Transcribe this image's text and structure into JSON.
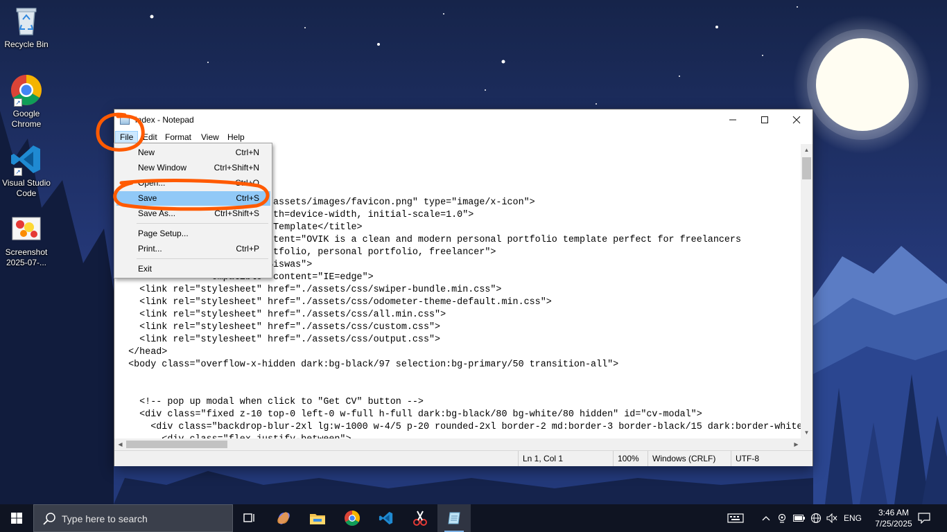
{
  "desktop": {
    "icons": [
      {
        "label": "Recycle Bin",
        "icon": "recycle-bin-icon"
      },
      {
        "label": "Google Chrome",
        "icon": "chrome-icon"
      },
      {
        "label": "Visual Studio Code",
        "icon": "vscode-icon"
      },
      {
        "label": "Screenshot 2025-07-...",
        "icon": "image-file-icon"
      }
    ]
  },
  "notepad": {
    "title": "index - Notepad",
    "menu": [
      "File",
      "Edit",
      "Format",
      "View",
      "Help"
    ],
    "active_menu": "File",
    "code_lines": [
      "",
      "",
      "",
      "",
      "                  \" href=\"./assets/images/favicon.png\" type=\"image/x-icon\">",
      "                 ontent=\"width=device-width, initial-scale=1.0\">",
      "                  Portfolio Template</title>",
      "                 iption\" content=\"OVIK is a clean and modern personal portfolio template perfect for freelancers",
      "                 ontent=\"portfolio, personal portfolio, freelancer\">",
      "                 ent=\"Ovik Biswas\">",
      "                 ompatible\" content=\"IE=edge\">",
      "    <link rel=\"stylesheet\" href=\"./assets/css/swiper-bundle.min.css\">",
      "    <link rel=\"stylesheet\" href=\"./assets/css/odometer-theme-default.min.css\">",
      "    <link rel=\"stylesheet\" href=\"./assets/css/all.min.css\">",
      "    <link rel=\"stylesheet\" href=\"./assets/css/custom.css\">",
      "    <link rel=\"stylesheet\" href=\"./assets/css/output.css\">",
      "  </head>",
      "  <body class=\"overflow-x-hidden dark:bg-black/97 selection:bg-primary/50 transition-all\">",
      "",
      "",
      "    <!-- pop up modal when click to \"Get CV\" button -->",
      "    <div class=\"fixed z-10 top-0 left-0 w-full h-full dark:bg-black/80 bg-white/80 hidden\" id=\"cv-modal\">",
      "      <div class=\"backdrop-blur-2xl lg:w-1000 w-4/5 p-20 rounded-2xl border-2 md:border-3 border-black/15 dark:border-white",
      "        <div class=\"flex justify-between\">"
    ],
    "file_menu": {
      "new": {
        "label": "New",
        "shortcut": "Ctrl+N"
      },
      "new_window": {
        "label": "New Window",
        "shortcut": "Ctrl+Shift+N"
      },
      "open": {
        "label": "Open...",
        "shortcut": "Ctrl+O"
      },
      "save": {
        "label": "Save",
        "shortcut": "Ctrl+S"
      },
      "save_as": {
        "label": "Save As...",
        "shortcut": "Ctrl+Shift+S"
      },
      "page_setup": {
        "label": "Page Setup...",
        "shortcut": ""
      },
      "print": {
        "label": "Print...",
        "shortcut": "Ctrl+P"
      },
      "exit": {
        "label": "Exit",
        "shortcut": ""
      }
    },
    "highlighted_item": "Save",
    "status": {
      "position": "Ln 1, Col 1",
      "zoom": "100%",
      "line_endings": "Windows (CRLF)",
      "encoding": "UTF-8"
    }
  },
  "taskbar": {
    "search_placeholder": "Type here to search",
    "pinned_apps": [
      "task-view-icon",
      "copilot-icon",
      "file-explorer-icon",
      "chrome-icon",
      "vscode-icon",
      "snipping-tool-icon",
      "notepad-icon"
    ],
    "language": "ENG",
    "time": "3:46 AM",
    "date": "7/25/2025"
  },
  "colors": {
    "annotation": "#ff5a00",
    "menu_highlight": "#91c9f7",
    "sky": "#1b2a52"
  }
}
